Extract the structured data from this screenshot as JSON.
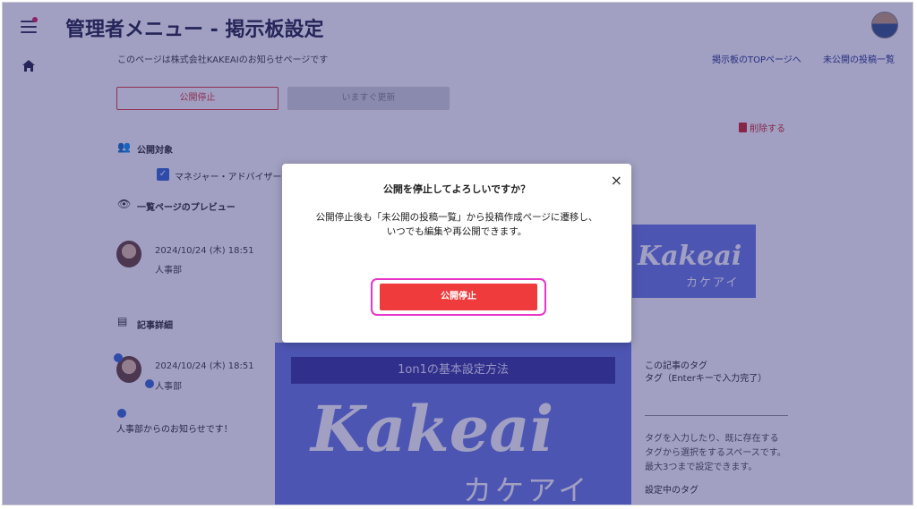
{
  "header": {
    "title": "管理者メニュー - 掲示板設定",
    "subtitle": "このページは株式会社KAKEAIのお知らせページです",
    "link_top": "掲示板のTOPページへ",
    "link_unpublished": "未公開の投稿一覧"
  },
  "actions": {
    "unpublish_label": "公開停止",
    "update_label": "いますぐ更新",
    "delete_label": "削除する"
  },
  "sections": {
    "target_label": "公開対象",
    "target_option": "マネジャー・アドバイザー",
    "preview_label": "一覧ページのプレビュー",
    "detail_label": "記事詳細"
  },
  "posts": {
    "preview": {
      "date": "2024/10/24 (木) 18:51",
      "dept": "人事部"
    },
    "detail": {
      "date": "2024/10/24 (木) 18:51",
      "dept": "人事部",
      "message": "人事部からのお知らせです！"
    }
  },
  "images": {
    "brand_en": "Kakeai",
    "brand_jp": "カケアイ",
    "banner_title": "1on1の基本設定方法"
  },
  "tags": {
    "heading": "この記事のタグ",
    "input_label": "タグ（Enterキーで入力完了）",
    "desc_lines": [
      "タグを入力したり、既に存在する",
      "タグから選択をするスペースです。",
      "最大3つまで設定できます。"
    ],
    "current_label": "設定中のタグ"
  },
  "modal": {
    "title": "公開を停止してよろしいですか？",
    "body_line1": "公開停止後も「未公開の投稿一覧」から投稿作成ページに遷移し、",
    "body_line2": "いつでも編集や再公開できます。",
    "confirm_label": "公開停止",
    "close_symbol": "×"
  },
  "colors": {
    "overlay": "#1e1c6e",
    "danger": "#ef3b3b",
    "highlight": "#e835c8",
    "brand_blue": "#6e7fe6"
  }
}
